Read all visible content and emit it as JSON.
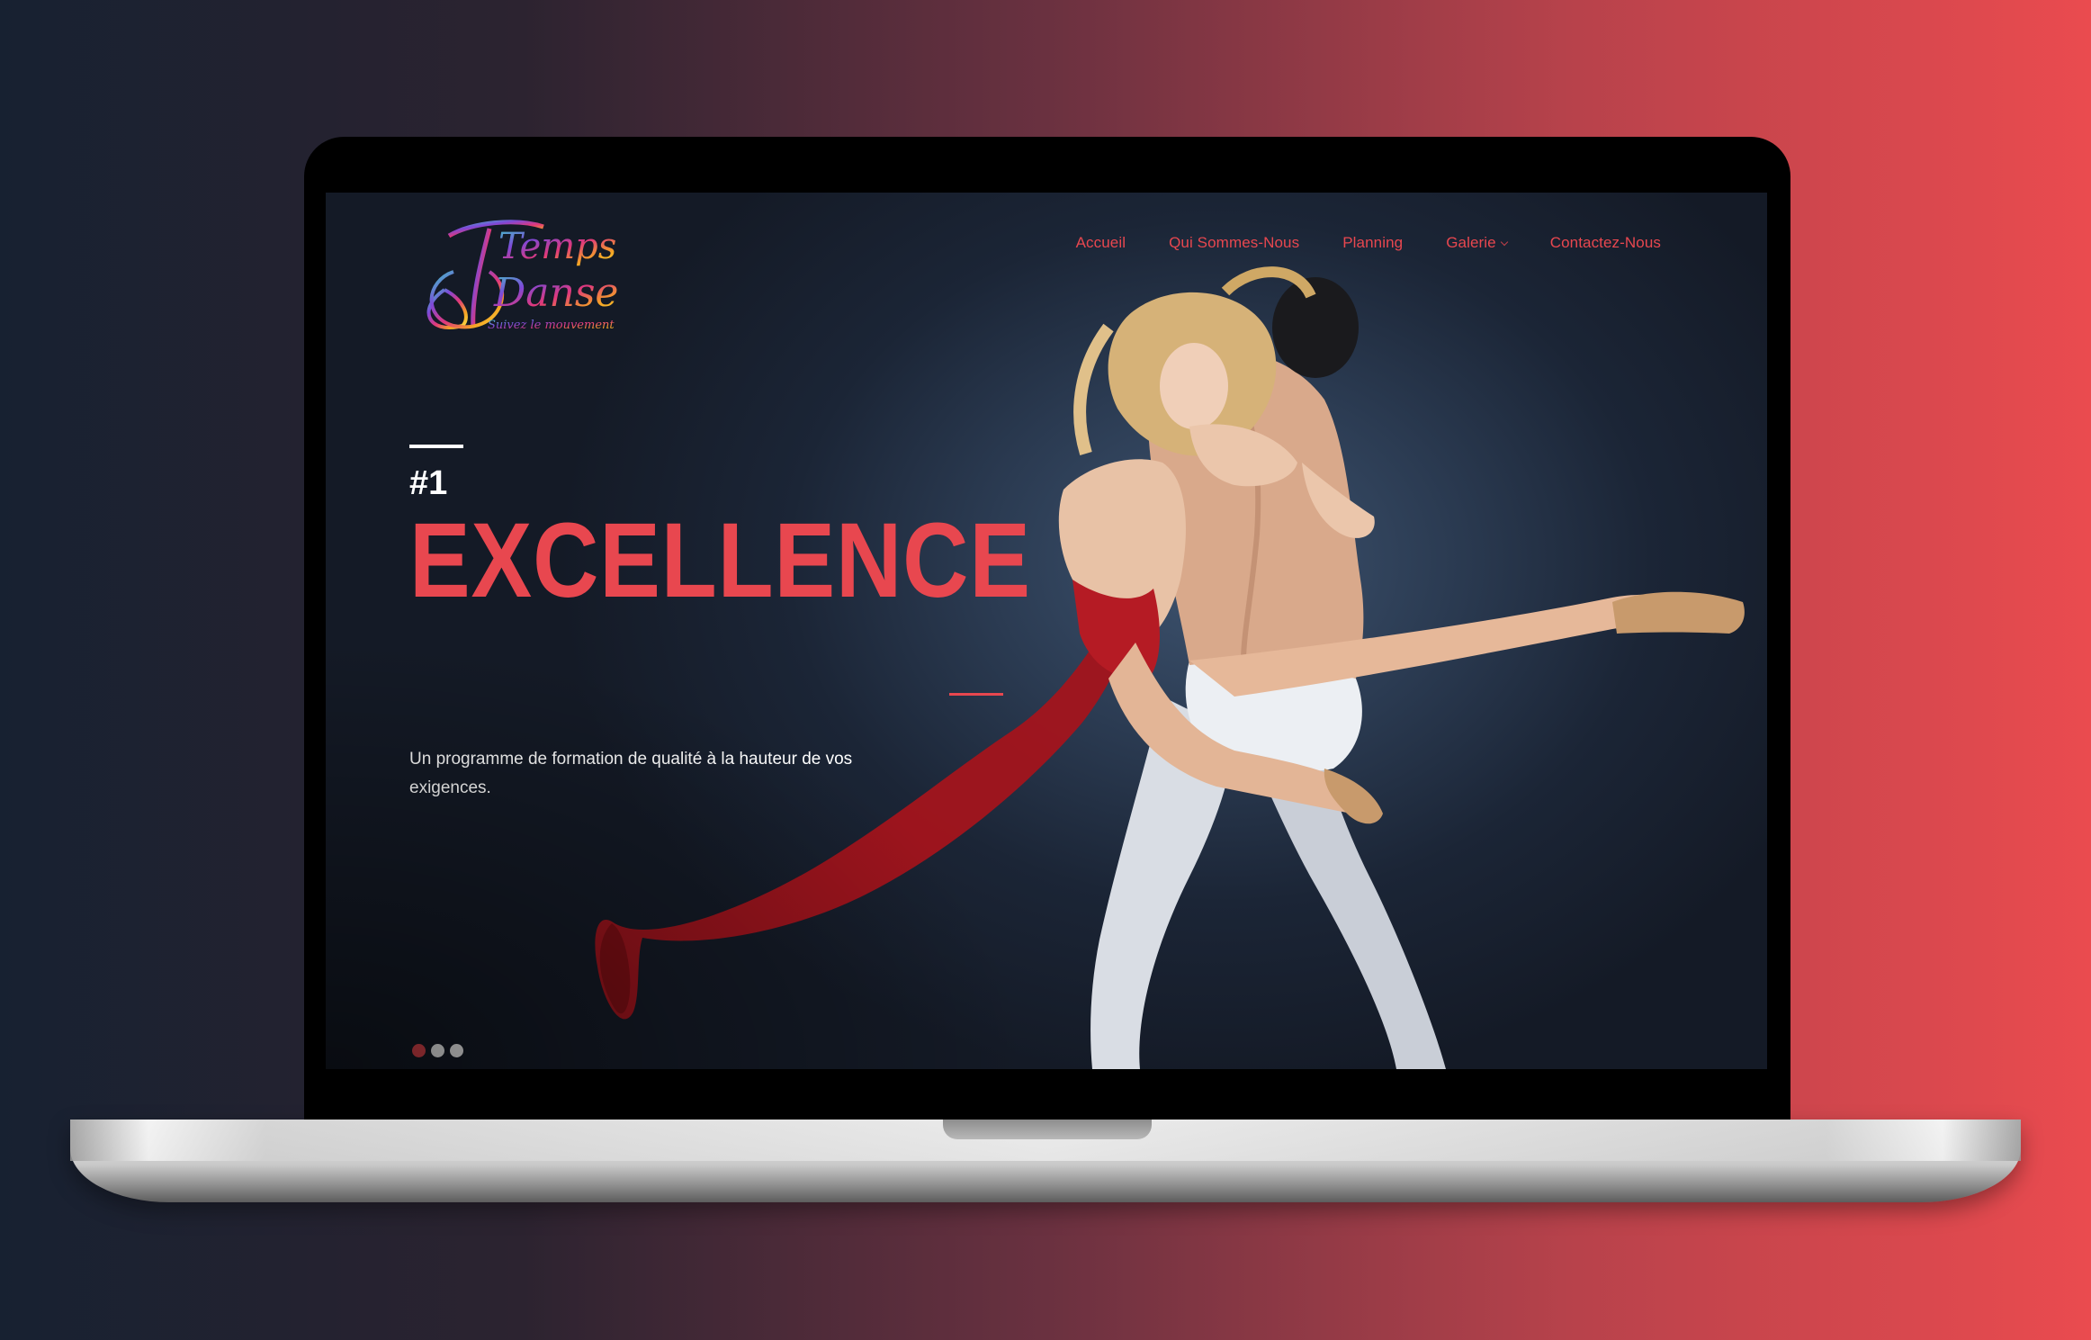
{
  "brand": {
    "logo_line1": "Temps",
    "logo_line2": "Danse",
    "logo_tagline": "Suivez le mouvement",
    "accent_color": "#e8474f"
  },
  "nav": {
    "items": [
      {
        "label": "Accueil"
      },
      {
        "label": "Qui Sommes-Nous"
      },
      {
        "label": "Planning"
      },
      {
        "label": "Galerie",
        "has_dropdown": true
      },
      {
        "label": "Contactez-Nous"
      }
    ]
  },
  "hero": {
    "kicker": "#1",
    "title": "EXCELLENCE",
    "description": "Un programme de formation de qualité à la hauteur de vos exigences."
  },
  "slider": {
    "slide_count": 3,
    "active_index": 0
  }
}
